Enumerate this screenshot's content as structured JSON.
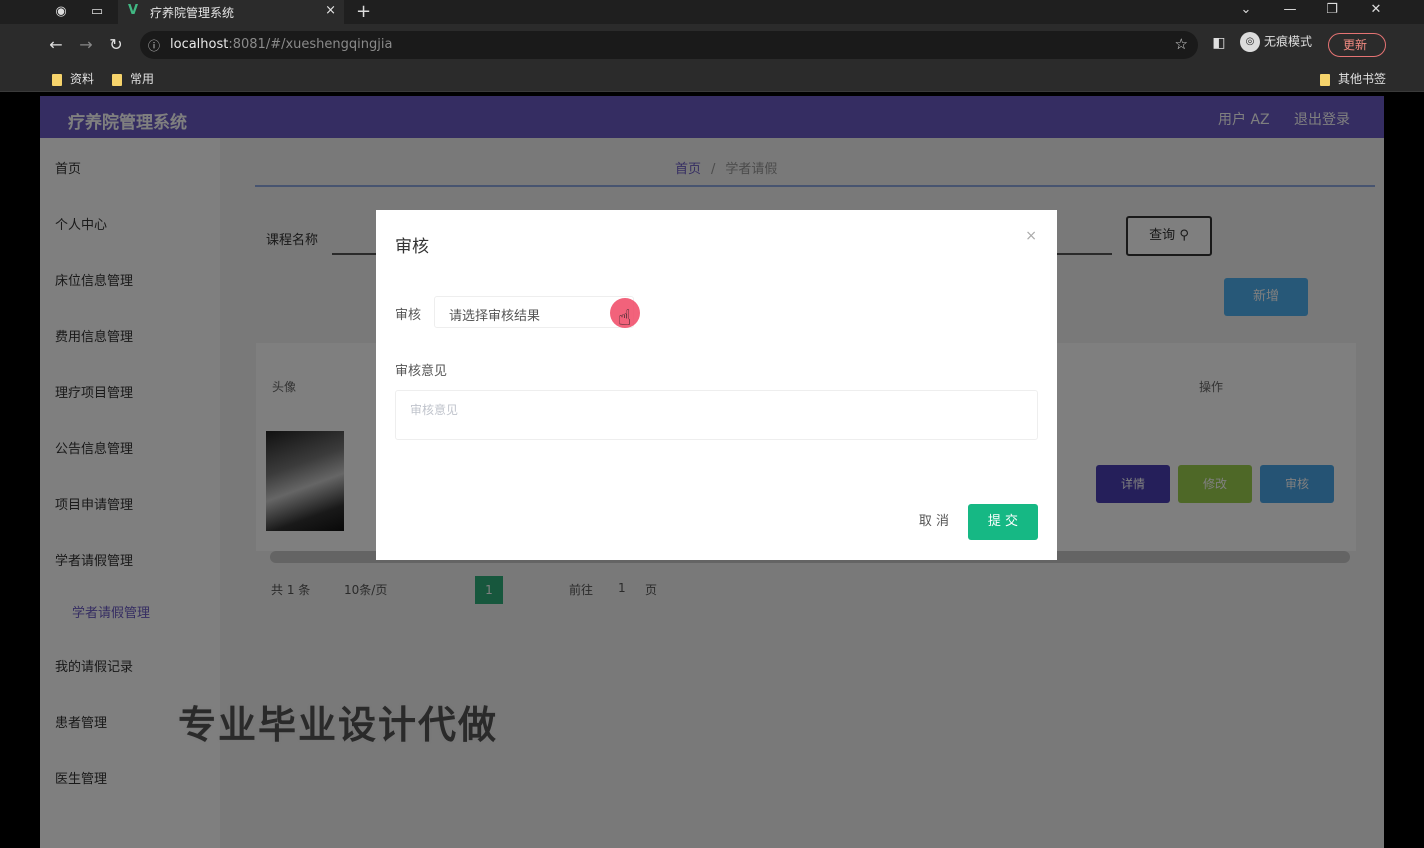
{
  "browser": {
    "tab_title": "疗养院管理系统",
    "tab_close": "×",
    "new_tab": "+",
    "url_host": "localhost",
    "url_rest": ":8081/#/xueshengqingjia",
    "incognito_label": "无痕模式",
    "update_label": "更新",
    "bookmarks": [
      "资料",
      "常用"
    ],
    "other_bookmarks": "其他书签"
  },
  "app": {
    "title": "疗养院管理系统",
    "user_label": "用户 AZ",
    "logout": "退出登录"
  },
  "sidebar": {
    "items": [
      "首页",
      "个人中心",
      "床位信息管理",
      "费用信息管理",
      "理疗项目管理",
      "公告信息管理",
      "项目申请管理",
      "学者请假管理",
      "学者请假管理",
      "我的请假记录",
      "患者管理",
      "医生管理"
    ]
  },
  "content": {
    "breadcrumb_home": "首页",
    "breadcrumb_sep": "/",
    "breadcrumb_current": "学者请假",
    "search_label": "课程名称",
    "search_button": "查询",
    "add_button": "新增",
    "table_headers": [
      "头像",
      "操作"
    ],
    "row_buttons": [
      "详情",
      "修改",
      "审核"
    ],
    "pager_total": "共 1 条",
    "pager_size": "10条/页",
    "pager_page": "1",
    "pager_goto": "前往",
    "pager_goto_num": "1",
    "pager_unit": "页"
  },
  "watermark": "专业毕业设计代做",
  "dialog": {
    "title": "审核",
    "close": "×",
    "audit_label": "审核",
    "audit_placeholder": "请选择审核结果",
    "opinion_label": "审核意见",
    "opinion_placeholder": "审核意见",
    "cancel": "取 消",
    "submit": "提 交"
  },
  "colors": {
    "header": "#6b5bc4",
    "submit": "#16b884",
    "detail": "#4a3fb5",
    "edit": "#9dd04e",
    "audit": "#4aa6e8"
  }
}
